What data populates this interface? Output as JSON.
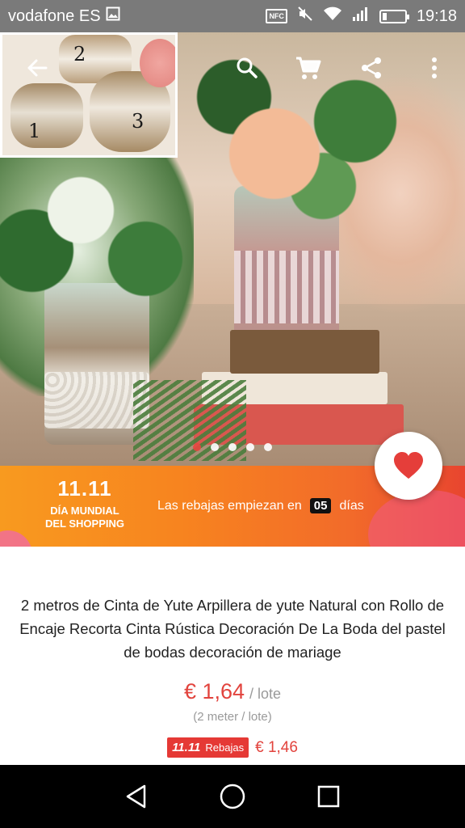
{
  "status_bar": {
    "carrier": "vodafone ES",
    "nfc_label": "NFC",
    "time": "19:18",
    "battery_level": 0.2
  },
  "gallery": {
    "inset_numbers": [
      "1",
      "2",
      "3"
    ],
    "page_count": 5,
    "active_index": 0,
    "icons": [
      "back-arrow-icon",
      "search-icon",
      "cart-icon",
      "share-icon",
      "more-vert-icon"
    ]
  },
  "banner": {
    "logo_mark": "11.11",
    "logo_text_line1": "DÍA MUNDIAL",
    "logo_text_line2": "DEL SHOPPING",
    "countdown_prefix": "Las rebajas empiezan en",
    "countdown_value": "05",
    "countdown_suffix": "días"
  },
  "product": {
    "title": "2 metros de Cinta de Yute Arpillera de yute Natural con Rollo de Encaje Recorta Cinta Rústica Decoración De La Boda del pastel de bodas decoración de mariage",
    "price": "€ 1,64",
    "price_unit": "/ lote",
    "sub_unit": "(2 meter / lote)",
    "sale_badge_mark": "11.11",
    "sale_badge_label": "Rebajas",
    "sale_price": "€ 1,46"
  },
  "colors": {
    "accent": "#e2433d",
    "banner_orange": "#f7831f",
    "status_bar": "#7a7a7a"
  }
}
